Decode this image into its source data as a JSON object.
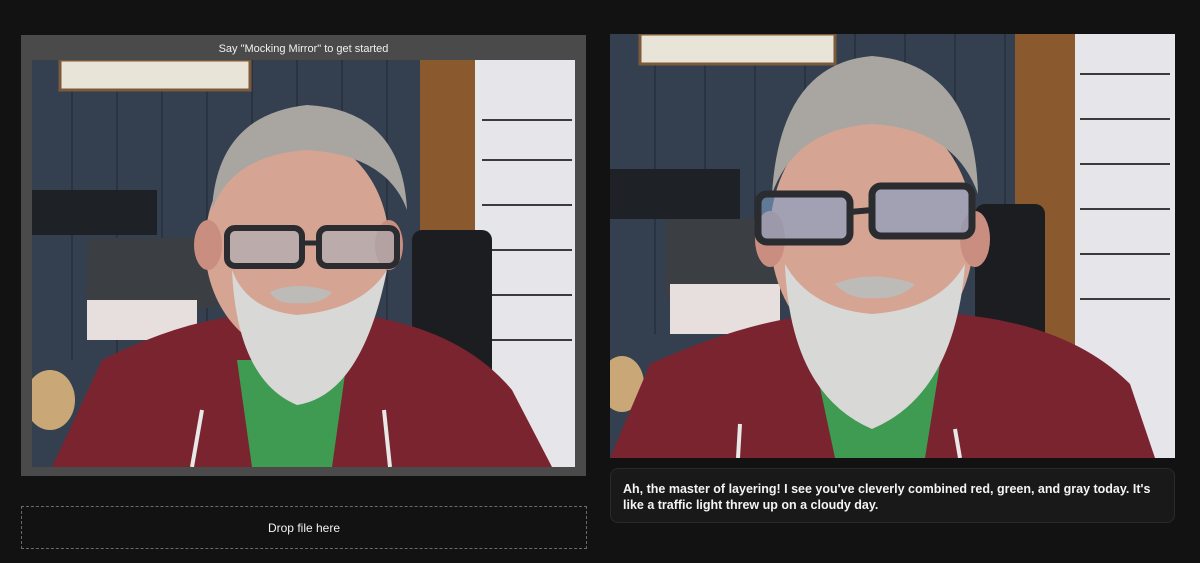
{
  "camera": {
    "caption": "Say \"Mocking Mirror\" to get started"
  },
  "drop_zone": {
    "label": "Drop file here"
  },
  "response": {
    "text": "Ah, the master of layering! I see you've cleverly combined red, green, and gray today. It's like a traffic light threw up on a cloudy day."
  },
  "colors": {
    "page_background": "#121212",
    "panel_background": "#4a4a4a",
    "hoodie_red": "#7a2430",
    "shirt_green": "#3f9a52",
    "wall_blue": "#34404f"
  }
}
